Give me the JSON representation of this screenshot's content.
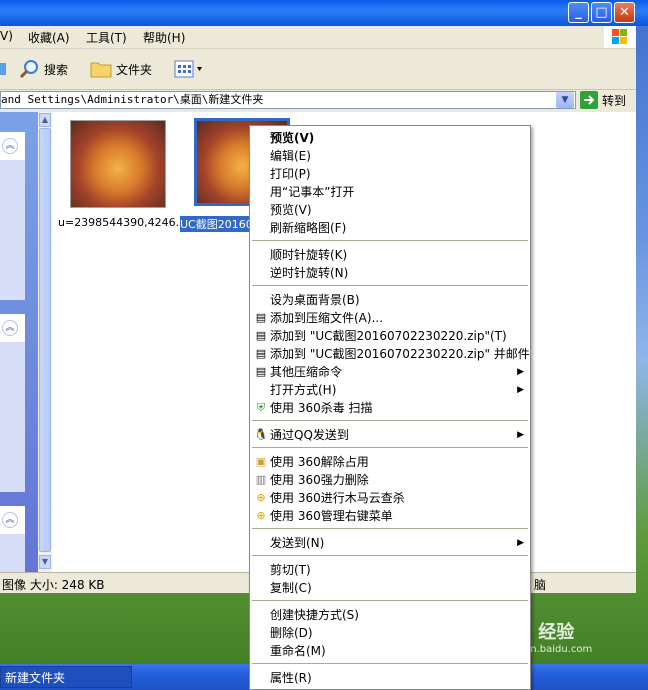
{
  "menubar": {
    "view": "V)",
    "favorites": "收藏(A)",
    "tools": "工具(T)",
    "help": "帮助(H)"
  },
  "toolbar": {
    "search": "搜索",
    "folders": "文件夹"
  },
  "address": {
    "path": "and Settings\\Administrator\\桌面\\新建文件夹",
    "go": "转到"
  },
  "files": [
    {
      "name": "u=2398544390,4246..."
    },
    {
      "name": "UC截图20160"
    }
  ],
  "status": {
    "left": "图像 大小: 248 KB",
    "right": "脑"
  },
  "taskbar": {
    "item": "新建文件夹"
  },
  "watermark": {
    "brand": "Bai 经验",
    "url": "jingyan.baidu.com"
  },
  "context_menu": {
    "group1": [
      {
        "label": "预览(V)",
        "bold": true
      },
      {
        "label": "编辑(E)"
      },
      {
        "label": "打印(P)"
      },
      {
        "label": "用“记事本”打开"
      },
      {
        "label": "预览(V)"
      },
      {
        "label": "刷新缩略图(F)"
      }
    ],
    "group2": [
      {
        "label": "顺时针旋转(K)"
      },
      {
        "label": "逆时针旋转(N)"
      }
    ],
    "group3": [
      {
        "label": "设为桌面背景(B)"
      },
      {
        "label": "添加到压缩文件(A)..."
      },
      {
        "label": "添加到 \"UC截图20160702230220.zip\"(T)"
      },
      {
        "label": "添加到 \"UC截图20160702230220.zip\" 并邮件"
      },
      {
        "label": "其他压缩命令",
        "submenu": true
      },
      {
        "label": "打开方式(H)",
        "submenu": true
      },
      {
        "label": "使用 360杀毒 扫描"
      }
    ],
    "group4": [
      {
        "label": "通过QQ发送到",
        "submenu": true
      }
    ],
    "group5": [
      {
        "label": "使用 360解除占用"
      },
      {
        "label": "使用 360强力删除"
      },
      {
        "label": "使用 360进行木马云查杀"
      },
      {
        "label": "使用 360管理右键菜单"
      }
    ],
    "group6": [
      {
        "label": "发送到(N)",
        "submenu": true
      }
    ],
    "group7": [
      {
        "label": "剪切(T)"
      },
      {
        "label": "复制(C)"
      }
    ],
    "group8": [
      {
        "label": "创建快捷方式(S)"
      },
      {
        "label": "删除(D)"
      },
      {
        "label": "重命名(M)"
      }
    ],
    "group9": [
      {
        "label": "属性(R)"
      }
    ]
  }
}
